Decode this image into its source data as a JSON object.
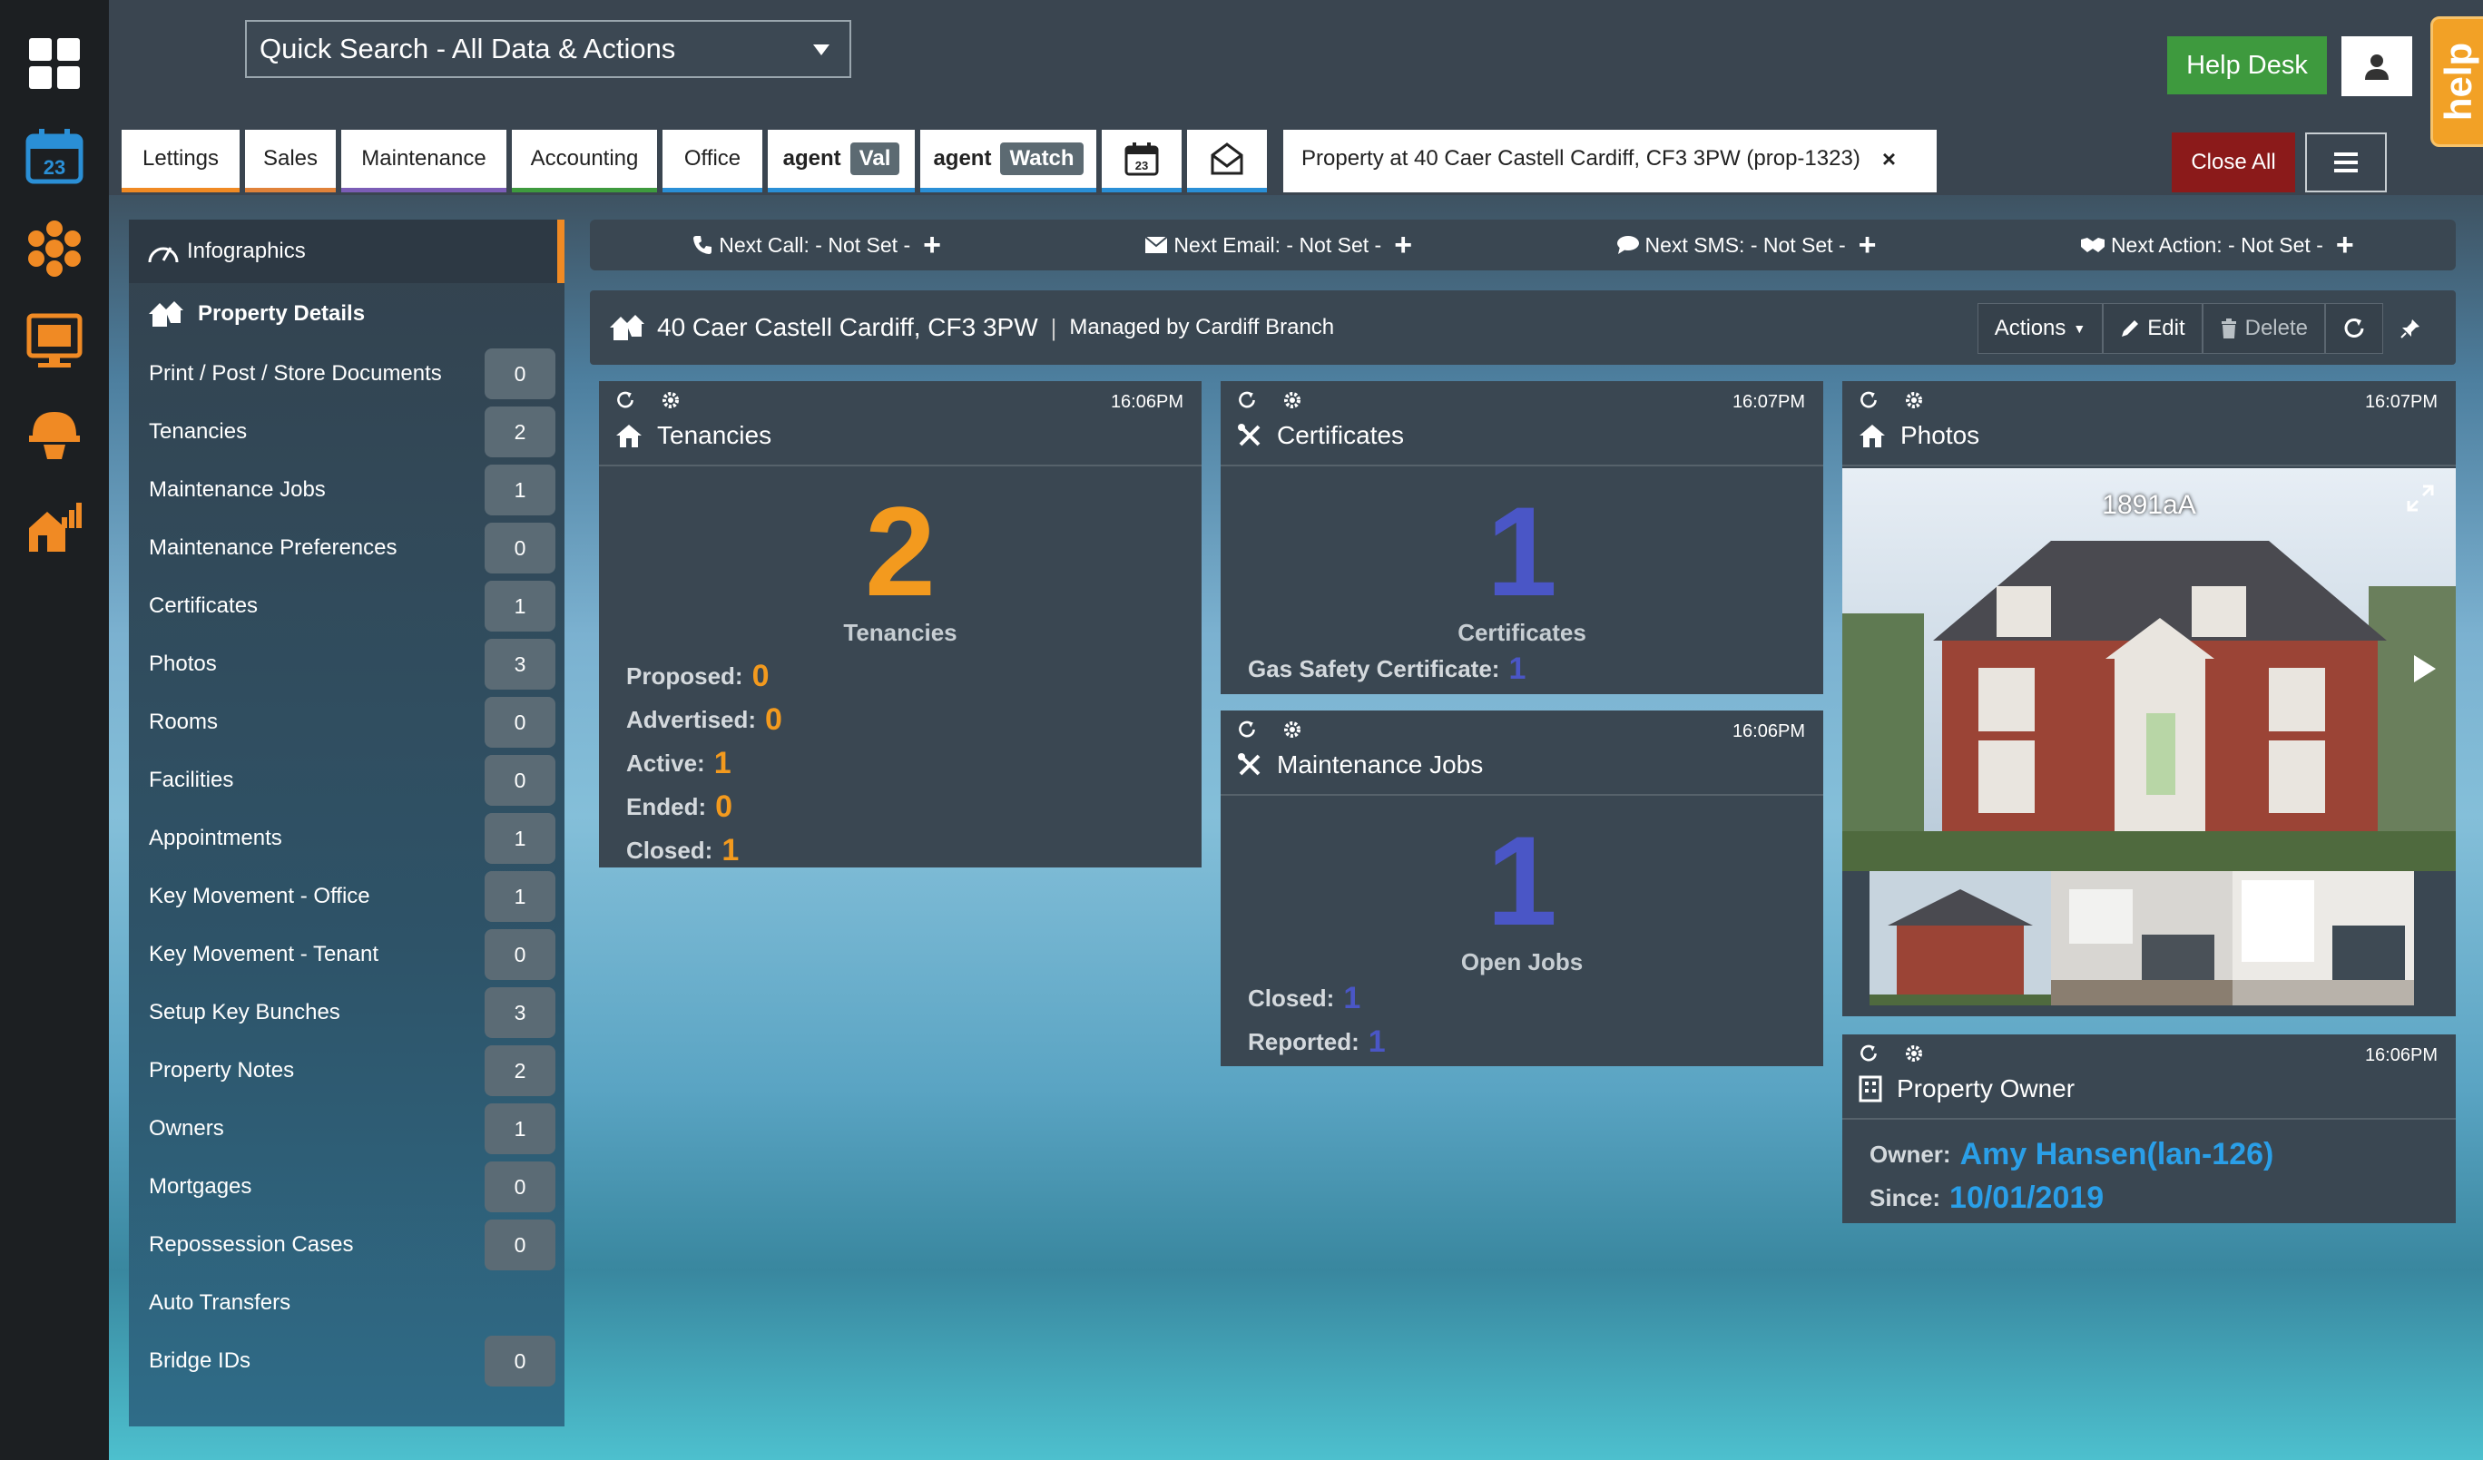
{
  "search": {
    "label": "Quick Search - All Data & Actions"
  },
  "header": {
    "helpdesk": "Help Desk",
    "help_tab": "help",
    "close_all": "Close All"
  },
  "tabs": [
    {
      "label": "Lettings",
      "accent": "#f08a24"
    },
    {
      "label": "Sales",
      "accent": "#e0823a"
    },
    {
      "label": "Maintenance",
      "accent": "#7b5db6"
    },
    {
      "label": "Accounting",
      "accent": "#3e9a3e"
    },
    {
      "label": "Office",
      "accent": "#2a8fd6"
    },
    {
      "agent": "agent",
      "pill": "Val",
      "accent": "#2a8fd6"
    },
    {
      "agent": "agent",
      "pill": "Watch",
      "accent": "#2a8fd6"
    }
  ],
  "calendar_day": "23",
  "doc_tab": {
    "label": "Property at 40 Caer Castell Cardiff, CF3 3PW (prop-1323)",
    "close": "×"
  },
  "sidebar": {
    "head": "Infographics",
    "section": "Property Details",
    "items": [
      {
        "label": "Print / Post / Store Documents",
        "count": "0"
      },
      {
        "label": "Tenancies",
        "count": "2"
      },
      {
        "label": "Maintenance Jobs",
        "count": "1"
      },
      {
        "label": "Maintenance Preferences",
        "count": "0"
      },
      {
        "label": "Certificates",
        "count": "1"
      },
      {
        "label": "Photos",
        "count": "3"
      },
      {
        "label": "Rooms",
        "count": "0"
      },
      {
        "label": "Facilities",
        "count": "0"
      },
      {
        "label": "Appointments",
        "count": "1"
      },
      {
        "label": "Key Movement - Office",
        "count": "1"
      },
      {
        "label": "Key Movement - Tenant",
        "count": "0"
      },
      {
        "label": "Setup Key Bunches",
        "count": "3"
      },
      {
        "label": "Property Notes",
        "count": "2"
      },
      {
        "label": "Owners",
        "count": "1"
      },
      {
        "label": "Mortgages",
        "count": "0"
      },
      {
        "label": "Repossession Cases",
        "count": "0"
      },
      {
        "label": "Auto Transfers",
        "count": null
      },
      {
        "label": "Bridge IDs",
        "count": "0"
      }
    ]
  },
  "quickbar": {
    "call": "Next Call: - Not Set -",
    "email": "Next Email: - Not Set -",
    "sms": "Next SMS: - Not Set -",
    "action": "Next Action: - Not Set -"
  },
  "property": {
    "address": "40 Caer Castell Cardiff, CF3 3PW",
    "separator": "|",
    "managed": "Managed by Cardiff Branch",
    "actions": "Actions",
    "edit": "Edit",
    "delete": "Delete"
  },
  "cards": {
    "tenancies": {
      "time": "16:06PM",
      "title": "Tenancies",
      "big": "2",
      "caption": "Tenancies",
      "rows": [
        {
          "label": "Proposed:",
          "value": "0"
        },
        {
          "label": "Advertised:",
          "value": "0"
        },
        {
          "label": "Active:",
          "value": "1"
        },
        {
          "label": "Ended:",
          "value": "0"
        },
        {
          "label": "Closed:",
          "value": "1"
        }
      ]
    },
    "certificates": {
      "time": "16:07PM",
      "title": "Certificates",
      "big": "1",
      "caption": "Certificates",
      "rows": [
        {
          "label": "Gas Safety Certificate:",
          "value": "1"
        }
      ]
    },
    "maintenance": {
      "time": "16:06PM",
      "title": "Maintenance Jobs",
      "big": "1",
      "caption": "Open Jobs",
      "rows": [
        {
          "label": "Closed:",
          "value": "1"
        },
        {
          "label": "Reported:",
          "value": "1"
        }
      ]
    },
    "photos": {
      "time": "16:07PM",
      "title": "Photos",
      "photo_label": "1891aA"
    },
    "owner": {
      "time": "16:06PM",
      "title": "Property Owner",
      "owner_label": "Owner:",
      "owner_value": "Amy Hansen(lan-126)",
      "since_label": "Since:",
      "since_value": "10/01/2019"
    }
  },
  "colors": {
    "orange": "#f39a1e",
    "blue": "#4a56c6",
    "cyan": "#2a9fe8",
    "help_desk_green": "#3e9a3e",
    "close_all_red": "#8b1a1a"
  }
}
